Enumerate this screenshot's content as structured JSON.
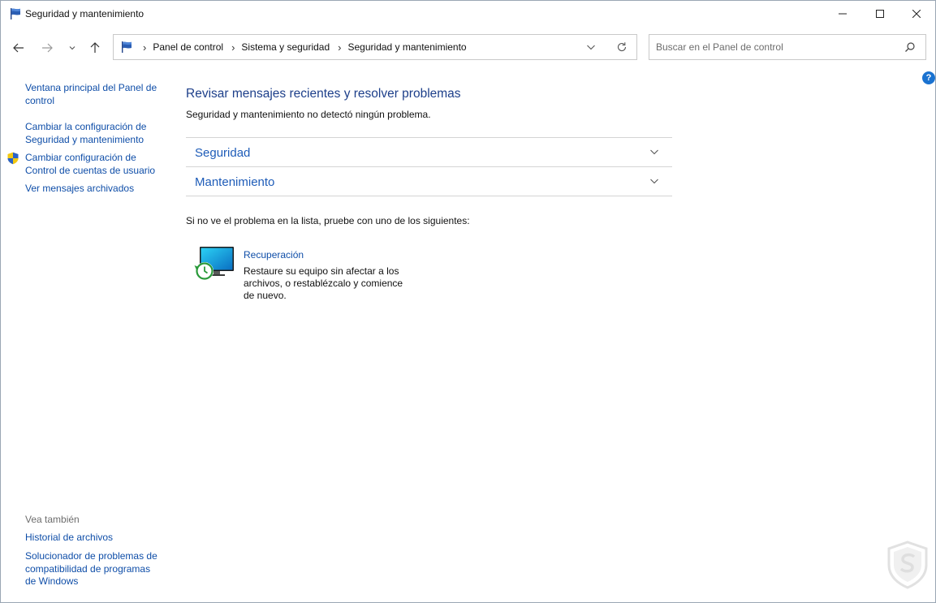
{
  "window": {
    "title": "Seguridad y mantenimiento"
  },
  "address": {
    "breadcrumbs": [
      "Panel de control",
      "Sistema y seguridad",
      "Seguridad y mantenimiento"
    ]
  },
  "search": {
    "placeholder": "Buscar en el Panel de control"
  },
  "help": {
    "glyph": "?"
  },
  "left_pane": {
    "links": [
      {
        "label": "Ventana principal del Panel de control"
      },
      {
        "label": "Cambiar la configuración de Seguridad y mantenimiento"
      },
      {
        "label": "Cambiar configuración de Control de cuentas de usuario"
      },
      {
        "label": "Ver mensajes archivados"
      }
    ],
    "see_also_title": "Vea también",
    "see_also": [
      {
        "label": "Historial de archivos"
      },
      {
        "label": "Solucionador de problemas de compatibilidad de programas de Windows"
      }
    ]
  },
  "main": {
    "title": "Revisar mensajes recientes y resolver problemas",
    "subtitle": "Seguridad y mantenimiento no detectó ningún problema.",
    "sections": [
      {
        "label": "Seguridad"
      },
      {
        "label": "Mantenimiento"
      }
    ],
    "hint": "Si no ve el problema en la lista, pruebe con uno de los siguientes:",
    "recovery": {
      "title": "Recuperación",
      "description": "Restaure su equipo sin afectar a los archivos, o restablézcalo y comience de nuevo."
    }
  },
  "colors": {
    "link": "#0f4ea8",
    "section_text": "#1e5cb8",
    "title": "#1d3f8a",
    "accent": "#1a72d0"
  },
  "icons": {
    "title": "flag-icon",
    "nav": [
      "back-arrow-icon",
      "forward-arrow-icon",
      "recent-dropdown-icon",
      "up-arrow-icon"
    ],
    "search": "search-icon",
    "uac": "shield-icon",
    "recovery": "recovery-icon",
    "logo": "logo-icon"
  }
}
